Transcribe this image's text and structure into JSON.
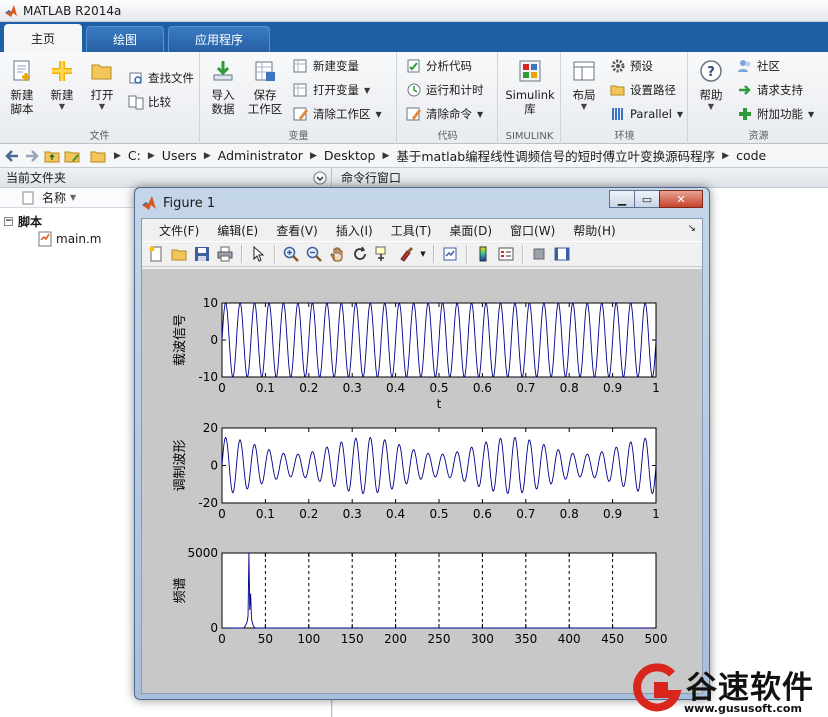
{
  "app": {
    "title": "MATLAB R2014a"
  },
  "tabs": [
    {
      "label": "主页",
      "active": true
    },
    {
      "label": "绘图",
      "active": false
    },
    {
      "label": "应用程序",
      "active": false
    }
  ],
  "ribbon": {
    "file": {
      "label": "文件",
      "new_script": "新建\n脚本",
      "new": "新建",
      "open": "打开",
      "find_files": "查找文件",
      "compare": "比较"
    },
    "variable": {
      "label": "变量",
      "import": "导入\n数据",
      "save_workspace": "保存\n工作区",
      "new_variable": "新建变量",
      "open_variable": "打开变量",
      "clear_workspace": "清除工作区"
    },
    "code": {
      "label": "代码",
      "analyze": "分析代码",
      "run_time": "运行和计时",
      "clear_commands": "清除命令"
    },
    "simulink": {
      "label": "SIMULINK",
      "library": "Simulink\n库"
    },
    "environment": {
      "label": "环境",
      "layout": "布局",
      "preferences": "预设",
      "set_path": "设置路径",
      "parallel": "Parallel"
    },
    "resources": {
      "label": "资源",
      "help": "帮助",
      "community": "社区",
      "support": "请求支持",
      "addons": "附加功能"
    }
  },
  "address": {
    "crumbs": [
      "C:",
      "Users",
      "Administrator",
      "Desktop",
      "基于matlab编程线性调频信号的短时傅立叶变换源码程序",
      "code"
    ]
  },
  "left_pane": {
    "title": "当前文件夹",
    "column_name": "名称",
    "group": "脚本",
    "file": "main.m"
  },
  "right_pane": {
    "title": "命令行窗口"
  },
  "figure": {
    "title": "Figure 1",
    "menu": [
      "文件(F)",
      "编辑(E)",
      "查看(V)",
      "插入(I)",
      "工具(T)",
      "桌面(D)",
      "窗口(W)",
      "帮助(H)"
    ],
    "toolbar_icons": [
      "new-figure-icon",
      "open-file-icon",
      "save-icon",
      "print-icon",
      "pointer-icon",
      "zoom-in-icon",
      "zoom-out-icon",
      "pan-icon",
      "rotate-icon",
      "data-cursor-icon",
      "brush-icon",
      "link-icon",
      "colorbar-icon",
      "legend-icon",
      "hide-plot-tools-icon",
      "show-plot-tools-icon"
    ]
  },
  "chart_data": [
    {
      "type": "line",
      "ylabel": "载波信号",
      "xlabel": "t",
      "xlim": [
        0,
        1
      ],
      "ylim": [
        -10,
        10
      ],
      "xticks": [
        "0",
        "0.1",
        "0.2",
        "0.3",
        "0.4",
        "0.5",
        "0.6",
        "0.7",
        "0.8",
        "0.9",
        "1"
      ],
      "yticks": [
        "-10",
        "0",
        "10"
      ],
      "series": [
        {
          "amplitude": 10,
          "frequency_hz": 30,
          "color": "#00008b"
        }
      ]
    },
    {
      "type": "line",
      "ylabel": "调制波形",
      "xlabel": "",
      "xlim": [
        0,
        1
      ],
      "ylim": [
        -20,
        20
      ],
      "xticks": [
        "0",
        "0.1",
        "0.2",
        "0.3",
        "0.4",
        "0.5",
        "0.6",
        "0.7",
        "0.8",
        "0.9",
        "1"
      ],
      "yticks": [
        "-20",
        "0",
        "20"
      ],
      "series": [
        {
          "carrier_frequency_hz": 30,
          "envelope_peak": 15,
          "envelope_min": 6,
          "envelope_frequency_hz": 3,
          "color": "#00008b"
        }
      ]
    },
    {
      "type": "line",
      "ylabel": "频谱",
      "xlabel": "",
      "xlim": [
        0,
        500
      ],
      "ylim": [
        0,
        5000
      ],
      "xticks": [
        "0",
        "50",
        "100",
        "150",
        "200",
        "250",
        "300",
        "350",
        "400",
        "450",
        "500"
      ],
      "yticks": [
        "0",
        "5000"
      ],
      "vertical_dashed_lines": [
        50,
        100,
        150,
        200,
        250,
        300,
        350,
        400,
        450
      ],
      "series": [
        {
          "peaks": [
            [
              27,
              150
            ],
            [
              29,
              420
            ],
            [
              30,
              800
            ],
            [
              31,
              5000
            ],
            [
              32,
              1200
            ],
            [
              33,
              2300
            ],
            [
              34,
              600
            ],
            [
              36,
              150
            ]
          ],
          "color": "#00008b"
        }
      ]
    }
  ],
  "watermark": {
    "name": "谷速软件",
    "url": "www.gususoft.com",
    "brand_color": "#d9261c"
  }
}
